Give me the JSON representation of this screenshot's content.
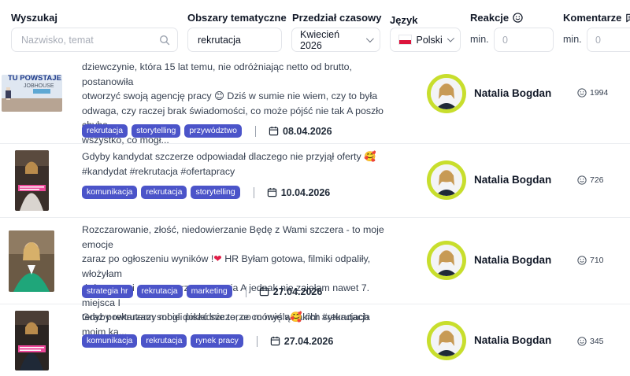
{
  "filters": {
    "search": {
      "label": "Wyszukaj",
      "placeholder": "Nazwisko, temat"
    },
    "topics": {
      "label": "Obszary tematyczne",
      "value": "rekrutacja"
    },
    "date_range": {
      "label": "Przedział czasowy",
      "value": "Kwiecień 2026"
    },
    "language": {
      "label": "Język",
      "value": "Polski"
    },
    "reactions": {
      "label": "Reakcje",
      "min_label": "min.",
      "placeholder": "0"
    },
    "comments": {
      "label": "Komentarze",
      "min_label": "min.",
      "placeholder": "0"
    }
  },
  "posts": [
    {
      "text_lines": [
        "dziewczynie, która 15 lat temu, nie odróżniając netto od brutto, postanowiła",
        "otworzyć swoją agencję pracy 😊 Dziś w sumie nie wiem, czy to była",
        "odwaga, czy raczej brak świadomości, co może pójść nie tak A poszło chyba",
        "wszystko, co mogł..."
      ],
      "thumb_text": "TU POWSTAJE",
      "thumb_text2": "JOBHOUSE",
      "tags": [
        "rekrutacja",
        "storytelling",
        "przywództwo"
      ],
      "date": "08.04.2026",
      "author": "Natalia Bogdan",
      "reactions": "1994"
    },
    {
      "text_lines": [
        "Gdyby kandydat szczerze odpowiadał dlaczego nie przyjął oferty 🥰",
        "#kandydat #rekrutacja #ofertapracy"
      ],
      "tags": [
        "komunikacja",
        "rekrutacja",
        "storytelling"
      ],
      "date": "10.04.2026",
      "author": "Natalia Bogdan",
      "reactions": "726"
    },
    {
      "text_lines": [
        "Rozczarowanie, złość, niedowierzanie Będę z Wami szczera - to moje emocje",
        "zaraz po ogłoszeniu wyników !",
        "dużo serca i czasu w przygotowania A jednak nie zajęłam nawet 7. miejsca I",
        "teraz powtarzam sobie dokładnie to, co mówię w takich sytuacjach moim ka..."
      ],
      "line2_after_heart": " HR Byłam gotowa, filmiki odpaliły, włożyłam",
      "heart": "❤",
      "tags": [
        "strategia hr",
        "rekrutacja",
        "marketing"
      ],
      "date": "27.04.2026",
      "author": "Natalia Bogdan",
      "reactions": "710"
    },
    {
      "text_lines": [
        "Gdyby rekruterzy mogli pisać szczerze co myślą🥰 #hr #rekrutacja"
      ],
      "tags": [
        "komunikacja",
        "rekrutacja",
        "rynek pracy"
      ],
      "date": "27.04.2026",
      "author": "Natalia Bogdan",
      "reactions": "345"
    }
  ],
  "colors": {
    "tag": "#4b54c9",
    "avatar_ring": "#c8de2d",
    "heart": "#e11d48"
  },
  "icons": [
    "search-icon",
    "smiley-icon",
    "comment-icon",
    "calendar-icon",
    "chevron-down-icon",
    "poland-flag-icon"
  ]
}
